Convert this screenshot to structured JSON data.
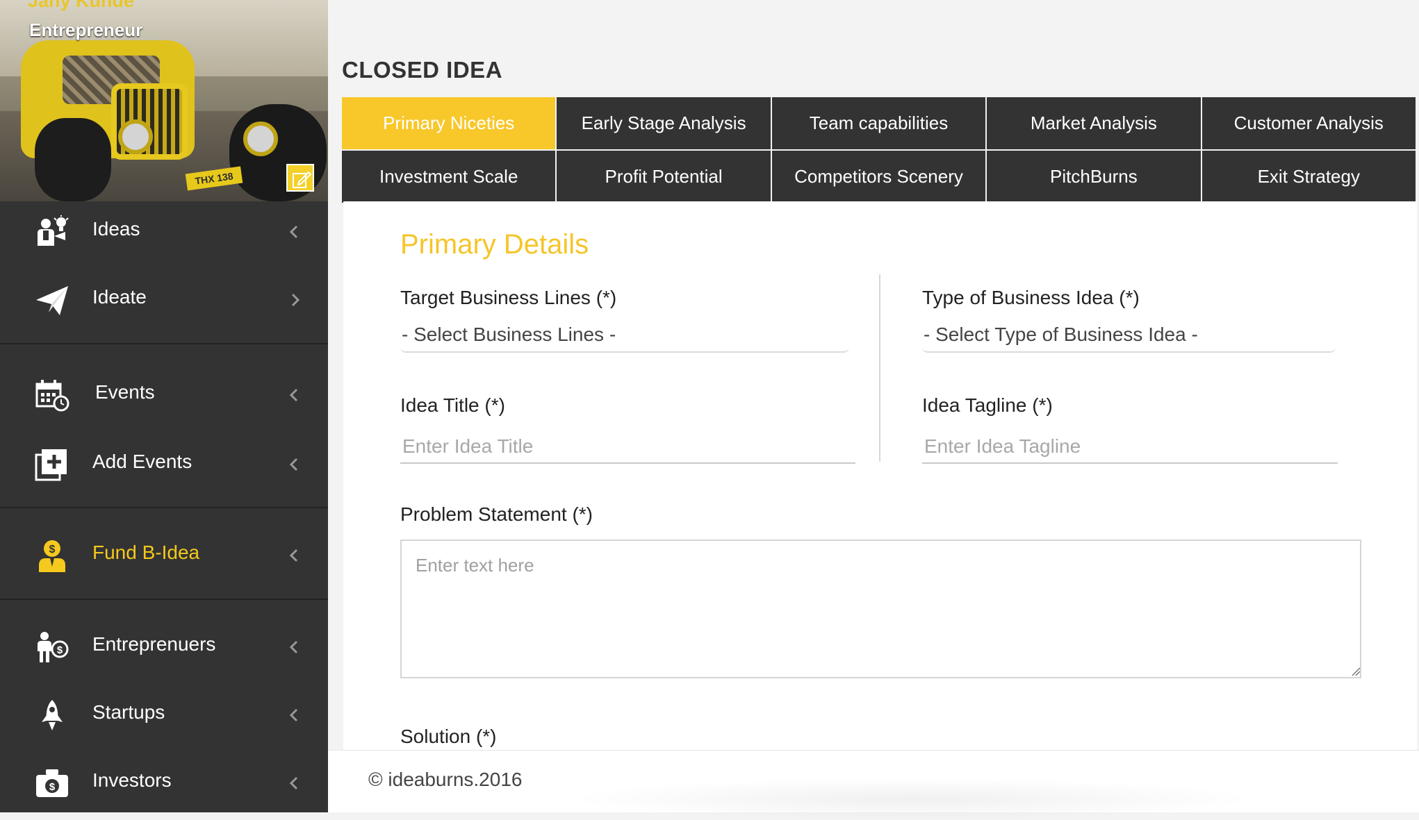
{
  "profile": {
    "user_name": "Jany Kunde",
    "user_role": "Entrepreneur",
    "photo_plate": "THX 138"
  },
  "sidebar": {
    "items": [
      {
        "label": "Ideas",
        "icon": "idea-person-icon",
        "chevron": "left"
      },
      {
        "label": "Ideate",
        "icon": "paper-plane-icon",
        "chevron": "right"
      },
      {
        "label": "Events",
        "icon": "calendar-clock-icon",
        "chevron": "left"
      },
      {
        "label": "Add Events",
        "icon": "add-square-icon",
        "chevron": "left"
      },
      {
        "label": "Fund B-Idea",
        "icon": "businessman-dollar-icon",
        "chevron": "left",
        "active": true
      },
      {
        "label": "Entreprenuers",
        "icon": "person-coin-icon",
        "chevron": "left"
      },
      {
        "label": "Startups",
        "icon": "rocket-icon",
        "chevron": "left"
      },
      {
        "label": "Investors",
        "icon": "cash-icon",
        "chevron": "left"
      }
    ]
  },
  "page": {
    "title": "CLOSED IDEA"
  },
  "tabs": [
    {
      "label": "Primary Niceties",
      "active": true
    },
    {
      "label": "Early Stage Analysis"
    },
    {
      "label": "Team capabilities"
    },
    {
      "label": "Market Analysis"
    },
    {
      "label": "Customer Analysis"
    },
    {
      "label": "Investment Scale"
    },
    {
      "label": "Profit Potential"
    },
    {
      "label": "Competitors Scenery"
    },
    {
      "label": "PitchBurns"
    },
    {
      "label": "Exit Strategy"
    }
  ],
  "form": {
    "section_title": "Primary Details",
    "business_lines": {
      "label": "Target Business Lines (*)",
      "value": "- Select Business Lines -"
    },
    "business_type": {
      "label": "Type of Business Idea (*)",
      "value": "- Select Type of Business Idea -"
    },
    "idea_title": {
      "label": "Idea Title (*)",
      "placeholder": "Enter Idea Title",
      "value": ""
    },
    "idea_tagline": {
      "label": "Idea Tagline (*)",
      "placeholder": "Enter Idea Tagline",
      "value": ""
    },
    "problem_statement": {
      "label": "Problem Statement (*)",
      "placeholder": "Enter text here",
      "value": ""
    },
    "solution": {
      "label": "Solution (*)"
    }
  },
  "footer": {
    "copyright": "© ideaburns.2016"
  },
  "colors": {
    "accent": "#f5c529",
    "sidebar_bg": "#333333",
    "tab_bg": "#333333",
    "tab_active_bg": "#f8c72a"
  }
}
